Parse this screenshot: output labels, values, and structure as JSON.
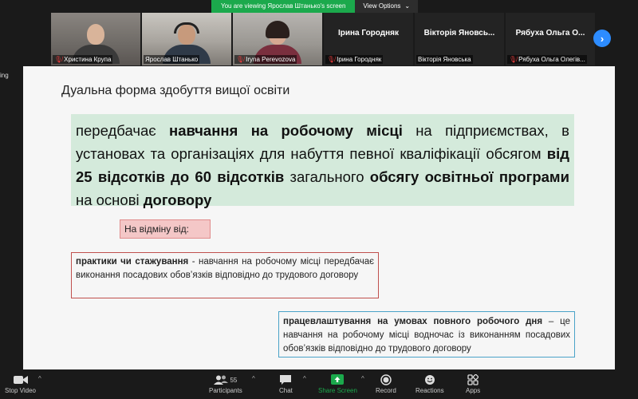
{
  "banner": {
    "viewing_text": "You are viewing Ярослав Штанько's screen",
    "view_options": "View Options"
  },
  "participants": [
    {
      "name": "Христина Крупа",
      "display": "video",
      "muted": true
    },
    {
      "name": "Ярослав Штанько",
      "display": "video",
      "muted": false,
      "active": true
    },
    {
      "name": "Iryna Perevozova",
      "display": "video",
      "muted": true
    },
    {
      "name": "Ірина Городняк",
      "display": "name",
      "tile_name": "Ірина Городняк",
      "muted": true
    },
    {
      "name": "Вікторія Яновська",
      "display": "name",
      "tile_name": "Вікторія Яновсь...",
      "muted": false
    },
    {
      "name": "Рябуха Ольга Олегів...",
      "display": "name",
      "tile_name": "Рябуха Ольга О...",
      "muted": true
    }
  ],
  "side_text": "ing",
  "slide": {
    "title": "Дуальна форма здобуття вищої освіти",
    "main": {
      "p1": "передбачає ",
      "b1": "навчання на робочому місці",
      "p2": " на підприємствах, в установах та організаціях для набуття певної кваліфікації обсягом ",
      "b2": "від 25 відсотків до 60 відсотків",
      "p3": " загального ",
      "b3": "обсягу освітньої програми",
      "p4": " на основі ",
      "b4": "договору"
    },
    "difference_label": "На відміну від:",
    "red_box": {
      "bold": "практики чи стажування",
      "text": " - навчання на робочому місці передбачає виконання посадових обов’язків відповідно до трудового договору"
    },
    "blue_box": {
      "bold": "працевлаштування на умовах повного робочого дня",
      "text": " – це навчання на робочому місці водночас із виконанням посадових обов’язків відповідно до трудового договору"
    }
  },
  "toolbar": {
    "stop_video": "Stop Video",
    "participants": "Participants",
    "participants_count": "55",
    "chat": "Chat",
    "share_screen": "Share Screen",
    "record": "Record",
    "reactions": "Reactions",
    "apps": "Apps"
  },
  "colors": {
    "share_green": "#1ba94c",
    "active_speaker": "#f2c40f",
    "next_button": "#2d8cff",
    "main_box_bg": "#d4eadb",
    "diff_box_bg": "#f4c7c7"
  }
}
